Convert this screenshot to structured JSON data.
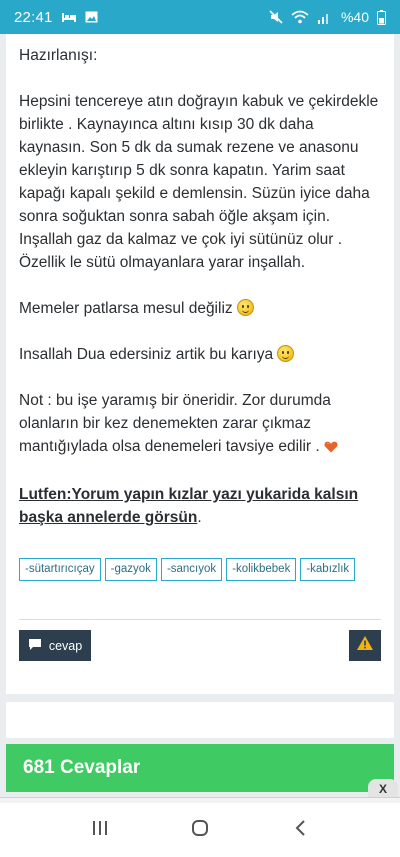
{
  "status_bar": {
    "time": "22:41",
    "battery": "%40",
    "icons": [
      "bed-icon",
      "gallery-icon",
      "mute-icon",
      "wifi-icon",
      "signal-icon",
      "battery-icon"
    ]
  },
  "post": {
    "heading": "Hazırlanışı:",
    "instructions": "Hepsini tencereye atın doğrayın kabuk ve çekirdekle birlikte . Kaynayınca altını kısıp 30 dk daha kaynasın. Son 5 dk da sumak rezene ve anasonu ekleyin karıştırıp 5 dk sonra kapatın.  Yarim saat kapağı kapalı şekild e demlensin.  Süzün iyice daha sonra soğuktan sonra sabah öğle akşam için.  Inşallah gaz da kalmaz ve çok iyi sütünüz olur . Özellik le sütü olmayanlara yarar inşallah.",
    "line_memeler": "Memeler patlarsa mesul değiliz",
    "line_dua": "Insallah Dua edersiniz artik bu karıya",
    "line_not": "Not : bu işe yaramış bir öneridir.  Zor durumda olanların bir kez denemekten zarar çıkmaz mantığıylada olsa denemeleri tavsiye edilir .",
    "cta": "Lutfen:Yorum yapın kızlar yazı yukarida kalsın başka annelerde görsün",
    "cta_end": "."
  },
  "tags": [
    "-sütartırıcıçay",
    "-gazyok",
    "-sancıyok",
    "-kolikbebek",
    "-kabızlık"
  ],
  "actions": {
    "reply_label": "cevap"
  },
  "answers_bar": {
    "label": "681 Cevaplar"
  },
  "ad": {
    "close_label": "X"
  },
  "colors": {
    "status_bar": "#2aa8c9",
    "answers_bar": "#3fca63",
    "button_dark": "#2d3f4f",
    "tag_border": "#2aa8c9"
  }
}
